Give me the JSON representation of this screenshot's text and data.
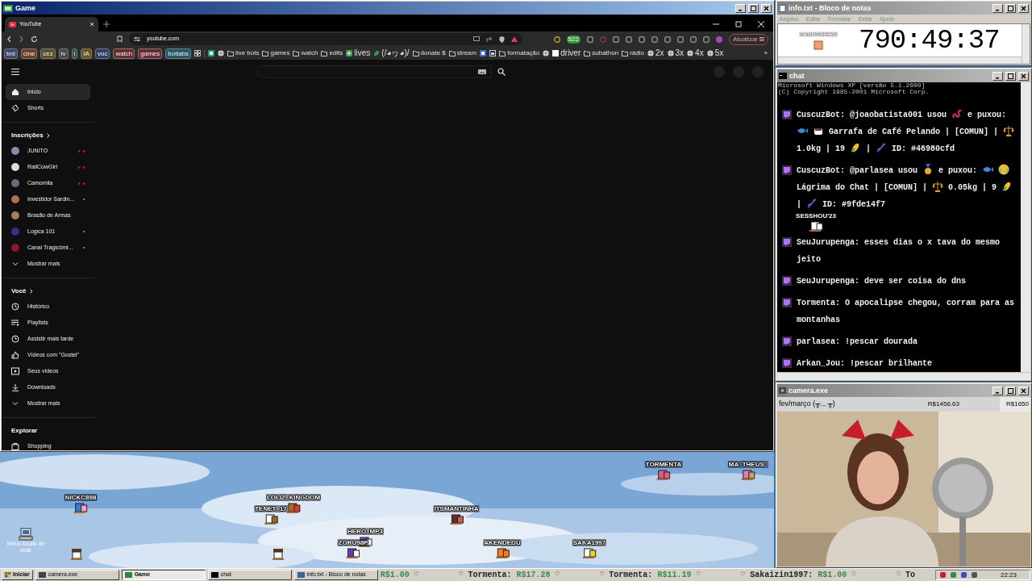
{
  "game_window": {
    "title": "Game",
    "browser": {
      "tabs": [
        {
          "label": "YouTube",
          "selected": true
        }
      ],
      "url": "youtube.com",
      "extension_badge": "522",
      "update_button": "Atualizar",
      "bookmarks": [
        {
          "kind": "tag",
          "label": "tml",
          "color": "#3b4a6b"
        },
        {
          "kind": "tag",
          "label": "cine",
          "color": "#6b3f2a"
        },
        {
          "kind": "tag",
          "label": "cez",
          "color": "#5a5228"
        },
        {
          "kind": "tag",
          "label": "lv",
          "color": "#4a4a4a"
        },
        {
          "kind": "tag",
          "label": "i",
          "color": "#2f5a3a"
        },
        {
          "kind": "tag",
          "label": "IA",
          "color": "#6a5a1e"
        },
        {
          "kind": "tag",
          "label": "voc",
          "color": "#2c3f6e"
        },
        {
          "kind": "tag",
          "label": "watch",
          "color": "#6e2a2a"
        },
        {
          "kind": "tag",
          "label": "games",
          "color": "#6e2a34"
        },
        {
          "kind": "tag",
          "label": "botlabs",
          "color": "#1f5a66"
        },
        {
          "kind": "apps"
        },
        {
          "kind": "site"
        },
        {
          "kind": "site"
        },
        {
          "kind": "folder",
          "label": "live bots"
        },
        {
          "kind": "folder",
          "label": "games"
        },
        {
          "kind": "folder",
          "label": "watch"
        },
        {
          "kind": "folder",
          "label": "edits"
        },
        {
          "kind": "site",
          "label": "lives"
        },
        {
          "kind": "site",
          "label": "(/◕ヮ◕)/"
        },
        {
          "kind": "folder",
          "label": "donate $"
        },
        {
          "kind": "folder",
          "label": "stream"
        },
        {
          "kind": "site"
        },
        {
          "kind": "site"
        },
        {
          "kind": "folder",
          "label": "formatação"
        },
        {
          "kind": "site"
        },
        {
          "kind": "site",
          "label": "driver"
        },
        {
          "kind": "folder",
          "label": "subathon"
        },
        {
          "kind": "folder",
          "label": "rádio"
        },
        {
          "kind": "site",
          "label": "2x"
        },
        {
          "kind": "site",
          "label": "3x"
        },
        {
          "kind": "site",
          "label": "4x"
        },
        {
          "kind": "site",
          "label": "5x"
        }
      ],
      "more_bookmarks": "»",
      "youtube": {
        "sections": [
          {
            "items": [
              {
                "kind": "nav",
                "label": "Início",
                "selected": true
              },
              {
                "kind": "nav",
                "label": "Shorts",
                "selected": false
              }
            ]
          },
          {
            "heading": "Inscrições",
            "items": [
              {
                "kind": "channel",
                "label": "JUNITO",
                "selected": false,
                "live": true,
                "new_content": false
              },
              {
                "kind": "channel",
                "label": "RailCowGirl",
                "selected": false,
                "live": true,
                "new_content": false
              },
              {
                "kind": "channel",
                "label": "Camomila",
                "selected": false,
                "live": true,
                "new_content": false
              },
              {
                "kind": "channel",
                "label": "Investidor Sardin...",
                "selected": false,
                "live": false,
                "new_content": true
              },
              {
                "kind": "channel",
                "label": "Brasão de Armas",
                "selected": false,
                "live": false,
                "new_content": false
              },
              {
                "kind": "channel",
                "label": "Logica 101",
                "selected": false,
                "live": false,
                "new_content": true
              },
              {
                "kind": "channel",
                "label": "Canal Tragicômi...",
                "selected": false,
                "live": false,
                "new_content": true
              },
              {
                "kind": "more",
                "label": "Mostrar mais",
                "selected": false
              }
            ]
          },
          {
            "heading": "Você",
            "items": [
              {
                "kind": "nav",
                "label": "Histórico",
                "selected": false
              },
              {
                "kind": "nav",
                "label": "Playlists",
                "selected": false
              },
              {
                "kind": "nav",
                "label": "Assistir mais tarde",
                "selected": false
              },
              {
                "kind": "nav",
                "label": "Vídeos com \"Gostei\"",
                "selected": false
              },
              {
                "kind": "nav",
                "label": "Seus vídeos",
                "selected": false
              },
              {
                "kind": "nav",
                "label": "Downloads",
                "selected": false
              },
              {
                "kind": "more",
                "label": "Mostrar mais",
                "selected": false
              }
            ]
          },
          {
            "heading": "Explorar",
            "items": [
              {
                "kind": "nav",
                "label": "Shopping",
                "selected": false
              }
            ]
          }
        ]
      }
    }
  },
  "notepad": {
    "title": "info.txt - Bloco de notas",
    "menu": [
      "Arquivo",
      "Editar",
      "Formatar",
      "Exibir",
      "Ajuda"
    ],
    "player": "SANDSCHE22",
    "timer": "790:49:37"
  },
  "chat_window": {
    "title": "chat",
    "header": [
      "Microsoft Windows XP [versão 5.1.2600]",
      "(C) Copyright 1985-2001 Microsoft Corp."
    ],
    "messages": [
      {
        "parts": [
          {
            "kind": "text",
            "text": "CuscuzBot: @joaobatista001 usou"
          },
          {
            "kind": "emoji"
          },
          {
            "kind": "text",
            "text": "e puxou:"
          },
          {
            "kind": "emoji"
          },
          {
            "kind": "emoji"
          },
          {
            "kind": "text",
            "text": "Garrafa de Café Pelando | [COMUN] |"
          },
          {
            "kind": "emoji"
          },
          {
            "kind": "text",
            "text": "1.0kg | 19"
          },
          {
            "kind": "emoji"
          },
          {
            "kind": "text",
            "text": "|"
          },
          {
            "kind": "emoji"
          },
          {
            "kind": "text",
            "text": "ID: #46980cfd"
          }
        ]
      },
      {
        "parts": [
          {
            "kind": "text",
            "text": "CuscuzBot: @parlasea usou"
          },
          {
            "kind": "emoji"
          },
          {
            "kind": "text",
            "text": "e puxou:"
          },
          {
            "kind": "emoji"
          },
          {
            "kind": "emoji"
          },
          {
            "kind": "text",
            "text": "Lágrima do Chat | [COMUN] |"
          },
          {
            "kind": "emoji"
          },
          {
            "kind": "text",
            "text": "0.05kg | 9"
          },
          {
            "kind": "emoji"
          },
          {
            "kind": "text",
            "text": "|"
          },
          {
            "kind": "emoji"
          },
          {
            "kind": "text",
            "text": "ID: #9fde14f7"
          }
        ]
      },
      {
        "parts": [
          {
            "kind": "text",
            "text": "SeuJurupenga: esses dias o x tava do mesmo jeito"
          }
        ]
      },
      {
        "parts": [
          {
            "kind": "text",
            "text": "SeuJurupenga: deve ser coisa do dns"
          }
        ]
      },
      {
        "parts": [
          {
            "kind": "text",
            "text": "Tormenta: O apocalipse chegou, corram para as montanhas"
          }
        ]
      },
      {
        "parts": [
          {
            "kind": "text",
            "text": "parlasea: !pescar dourada"
          }
        ]
      },
      {
        "parts": [
          {
            "kind": "text",
            "text": "Arkan_Jou: !pescar brilhante"
          }
        ]
      }
    ]
  },
  "camera_window": {
    "title": "camera.exe",
    "goal_label": "fev/março (╥﹏╥)",
    "amount": "R$1456.63",
    "goal": "R$1650",
    "level": 0.88
  },
  "desktop": {
    "icon_label": "Meus locais de rede",
    "players": [
      "NICKC898",
      "LOLIZ_KINGDOM",
      "TENET_17",
      "ITSMANTINHA",
      "HERO_MP3",
      "ZORU98P",
      "AKENDEDU",
      "SAKA1997",
      "TORMENTA",
      "MA_THEUS_",
      "SESSHOU'23"
    ]
  },
  "taskbar": {
    "start": "Iniciar",
    "tasks": [
      {
        "label": "camera.exe",
        "selected": false
      },
      {
        "label": "Game",
        "selected": true
      },
      {
        "label": "chat",
        "selected": false
      },
      {
        "label": "info.txt - Bloco de notas",
        "selected": false
      }
    ],
    "ticker": [
      {
        "kind": "amount",
        "text": "R$1.00"
      },
      {
        "kind": "heart",
        "text": "♡"
      },
      {
        "kind": "heart",
        "text": "♡"
      },
      {
        "kind": "name",
        "text": "Tormenta:"
      },
      {
        "kind": "amount",
        "text": "R$17.28"
      },
      {
        "kind": "heart",
        "text": "♡"
      },
      {
        "kind": "heart",
        "text": "♡"
      },
      {
        "kind": "name",
        "text": "Tormenta:"
      },
      {
        "kind": "amount",
        "text": "R$11.19"
      },
      {
        "kind": "heart",
        "text": "♡"
      },
      {
        "kind": "heart",
        "text": "♡"
      },
      {
        "kind": "name",
        "text": "Sakaizin1997:"
      },
      {
        "kind": "amount",
        "text": "R$1.00"
      },
      {
        "kind": "heart",
        "text": "♡"
      },
      {
        "kind": "heart",
        "text": "♡"
      },
      {
        "kind": "name",
        "text": "To"
      }
    ],
    "clock": "22:23"
  }
}
